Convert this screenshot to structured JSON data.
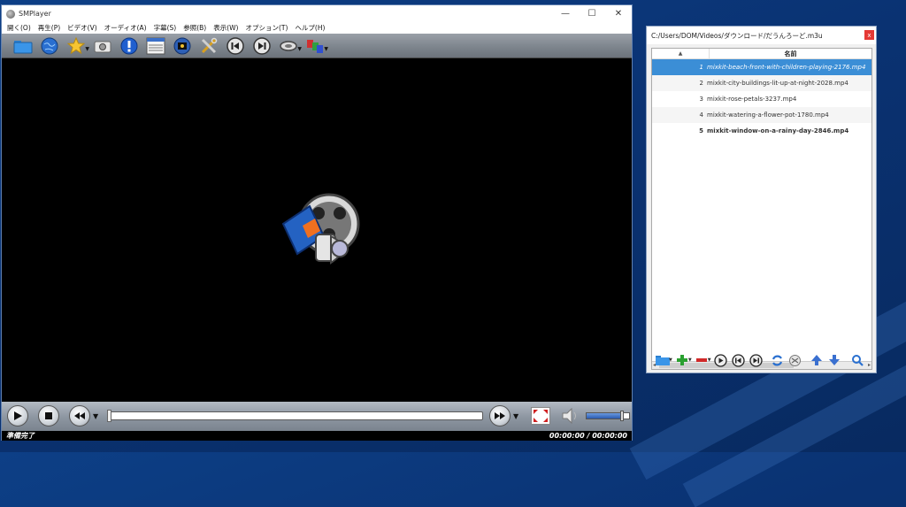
{
  "player": {
    "title": "SMPlayer",
    "menu": [
      "開く(O)",
      "再生(P)",
      "ビデオ(V)",
      "オーディオ(A)",
      "字幕(S)",
      "参照(B)",
      "表示(W)",
      "オプション(T)",
      "ヘルプ(H)"
    ],
    "toolbar_icons": [
      "open-folder-icon",
      "globe-icon",
      "favorites-star-icon",
      "screenshot-camera-icon",
      "info-icon",
      "playlist-icon",
      "disk-icon",
      "preferences-tools-icon",
      "previous-icon",
      "next-icon",
      "audio-tracks-icon",
      "subtitles-icon"
    ],
    "status_text": "準備完了",
    "time_text": "00:00:00 / 00:00:00",
    "volume_fraction": 0.85,
    "seek_fraction": 0.0
  },
  "playlist": {
    "title": "C:/Users/DOM/Videos/ダウンロード/だうんろーど.m3u",
    "column_header": "名前",
    "rows": [
      {
        "num": "1",
        "name": "mixkit-beach-front-with-children-playing-2176.mp4"
      },
      {
        "num": "2",
        "name": "mixkit-city-buildings-lit-up-at-night-2028.mp4"
      },
      {
        "num": "3",
        "name": "mixkit-rose-petals-3237.mp4"
      },
      {
        "num": "4",
        "name": "mixkit-watering-a-flower-pot-1780.mp4"
      },
      {
        "num": "5",
        "name": "mixkit-window-on-a-rainy-day-2846.mp4"
      }
    ],
    "selected_index": 0,
    "bold_index": 4
  },
  "colors": {
    "accent": "#3b8ed6",
    "close": "#e53935"
  }
}
